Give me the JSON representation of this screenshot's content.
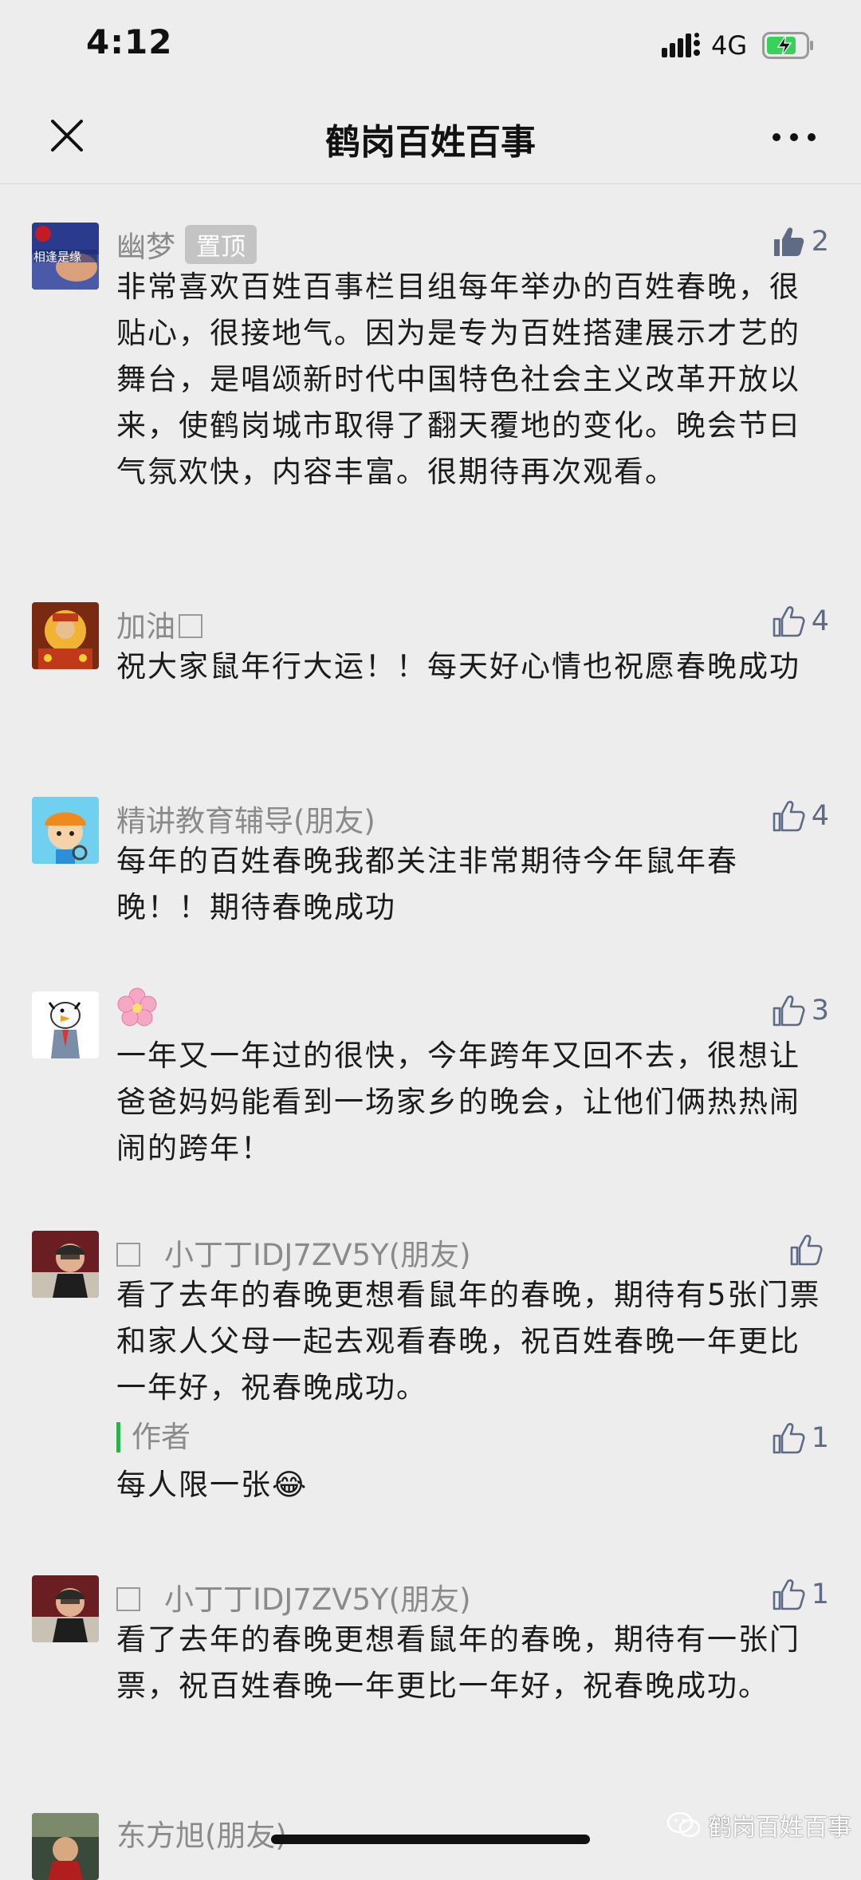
{
  "status_bar": {
    "time": "4:12",
    "network": "4G"
  },
  "nav": {
    "title": "鹤岗百姓百事"
  },
  "comments": [
    {
      "name": "幽梦",
      "badge": "置顶",
      "likes": "2",
      "liked": true,
      "text": "非常喜欢百姓百事栏目组每年举办的百姓春晚，很贴心，很接地气。因为是专为百姓搭建展示才艺的舞台，是唱颂新时代中国特色社会主义改革开放以来，使鹤岗城市取得了翻天覆地的变化。晚会节曰气氛欢快，内容丰富。很期待再次观看。",
      "avatar_text": "相逢是缘"
    },
    {
      "name": "加油",
      "likes": "4",
      "text": "祝大家鼠年行大运！！每天好心情也祝愿春晚成功"
    },
    {
      "name": "精讲教育辅导(朋友)",
      "likes": "4",
      "text": "每年的百姓春晚我都关注非常期待今年鼠年春晚！！期待春晚成功"
    },
    {
      "name": "🌸",
      "likes": "3",
      "text": "一年又一年过的很快，今年跨年又回不去，很想让爸爸妈妈能看到一场家乡的晚会，让他们俩热热闹闹的跨年！"
    },
    {
      "name": "小丁丁IDJ7ZV5Y(朋友)",
      "likes": "",
      "text": "看了去年的春晚更想看鼠年的春晚，期待有5张门票和家人父母一起去观看春晚，祝百姓春晚一年更比一年好，祝春晚成功。",
      "reply": {
        "author_label": "作者",
        "likes": "1",
        "text": "每人限一张😂"
      }
    },
    {
      "name": "小丁丁IDJ7ZV5Y(朋友)",
      "likes": "1",
      "text": "看了去年的春晚更想看鼠年的春晚，期待有一张门票，祝百姓春晚一年更比一年好，祝春晚成功。"
    },
    {
      "name": "东方旭(朋友)"
    }
  ],
  "watermark": "鹤岗百姓百事",
  "colors": {
    "background": "#ededed",
    "name_gray": "#8a8a8a",
    "like_blue": "#5f6b85",
    "author_green": "#2bb24c"
  }
}
